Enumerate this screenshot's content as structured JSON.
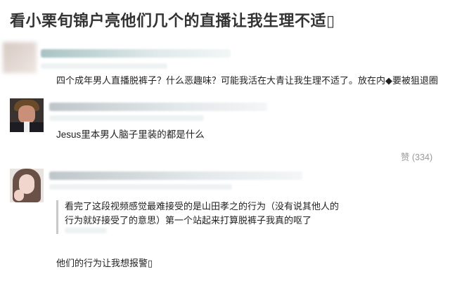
{
  "post": {
    "title": "看小栗旬锦户亮他们几个的直播让我生理不适▯"
  },
  "comments": [
    {
      "text": "四个成年男人直播脱裤子？什么恶趣味？可能我活在大青让我生理不适了。放在内◆要被狙退圈"
    },
    {
      "text": "Jesus里本男人脑子里装的都是什么",
      "like_label": "赞 (334)"
    },
    {
      "quote_lines": [
        "看完了这段视频感觉最难接受的是山田孝之的行为（没有说其他人的",
        "行为就好接受了的意思）第一个站起来打算脱裤子我真的呕了"
      ],
      "text": "他们的行为让我想报警▯"
    }
  ],
  "icons": {
    "comment1_avatar": "blurred-avatar",
    "comment2_avatar": "man-in-suit-avatar",
    "comment3_avatar": "woman-avatar"
  }
}
